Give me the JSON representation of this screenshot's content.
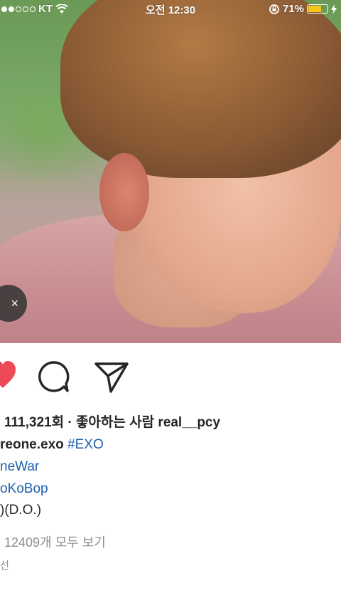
{
  "status_bar": {
    "carrier": "KT",
    "time": "오전 12:30",
    "battery_percent": "71%",
    "battery_level": 0.71,
    "battery_color": "#f5c518"
  },
  "post": {
    "close_icon": "×",
    "likes_text": "111,321회 · 좋아하는 사람 real__pcy",
    "caption_user": "reone.exo",
    "caption_tag": "#EXO",
    "tag_line_2": "neWar",
    "tag_line_3": "oKoBop",
    "tag_line_4": ")(D.O.)",
    "view_comments": "12409개 모두 보기",
    "time_ago": "선"
  },
  "colors": {
    "like_red": "#ed4956",
    "hashtag_blue": "#1d5fae",
    "muted_gray": "#8e8e8e"
  },
  "icons": [
    "heart-icon",
    "comment-icon",
    "share-icon",
    "wifi-icon",
    "rotation-lock-icon",
    "charging-icon"
  ]
}
